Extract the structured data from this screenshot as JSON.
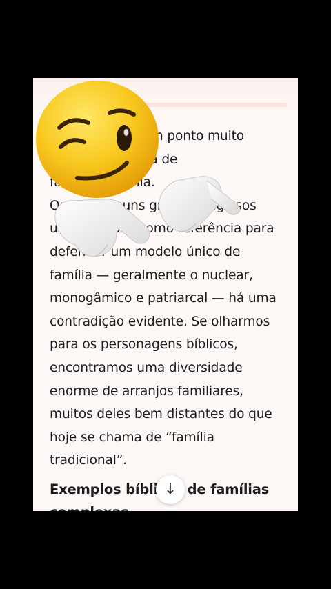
{
  "article": {
    "paragraph_lines": [
      "é tratado com um ponto muito",
      "polêmico: a ideia de",
      "família na Bíblia.",
      "Quando alguns grupos religiosos",
      "usam a Bíblia como referência para",
      "defender um modelo único de",
      "família — geralmente o nuclear,",
      "monogâmico e patriarcal — há uma",
      "contradição evidente. Se olharmos",
      "para os personagens bíblicos,",
      "encontramos uma diversidade",
      "enorme de arranjos familiares,",
      "muitos deles bem distantes do que",
      "hoje se chama de “família",
      "tradicional”."
    ],
    "heading_lines": [
      "Exemplos bíblicos de famílias",
      "complexas"
    ]
  },
  "scroll_button": {
    "icon": "arrow-down-icon",
    "glyph": "↓"
  },
  "overlay": {
    "emoji": "winking-face-emoji",
    "hands": "pointing-hands"
  },
  "colors": {
    "screen_bg": "#000000",
    "card_bg": "#fdf8f6",
    "text": "#1e1e1e",
    "emoji_yellow": "#f6c21a"
  }
}
